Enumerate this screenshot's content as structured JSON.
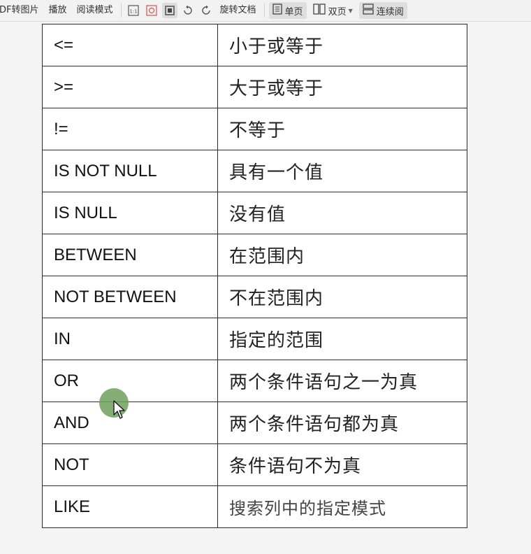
{
  "toolbar": {
    "pdf_to_image": "DF转图片",
    "play": "播放",
    "reading_mode": "阅读模式",
    "actual_size_icon": "1:1",
    "rotate_doc": "旋转文档",
    "single_page": "单页",
    "double_page": "双页",
    "continuous": "连续阅"
  },
  "table": {
    "rows": [
      {
        "op": "<=",
        "desc": "小于或等于"
      },
      {
        "op": ">=",
        "desc": "大于或等于"
      },
      {
        "op": "!=",
        "desc": "不等于"
      },
      {
        "op": "IS NOT NULL",
        "desc": "具有一个值"
      },
      {
        "op": "IS NULL",
        "desc": "没有值"
      },
      {
        "op": "BETWEEN",
        "desc": "在范围内"
      },
      {
        "op": "NOT BETWEEN",
        "desc": "不在范围内"
      },
      {
        "op": "IN",
        "desc": "指定的范围"
      },
      {
        "op": "OR",
        "desc": "两个条件语句之一为真"
      },
      {
        "op": "AND",
        "desc": "两个条件语句都为真"
      },
      {
        "op": "NOT",
        "desc": "条件语句不为真"
      },
      {
        "op": "LIKE",
        "desc": "搜索列中的指定模式"
      }
    ]
  }
}
